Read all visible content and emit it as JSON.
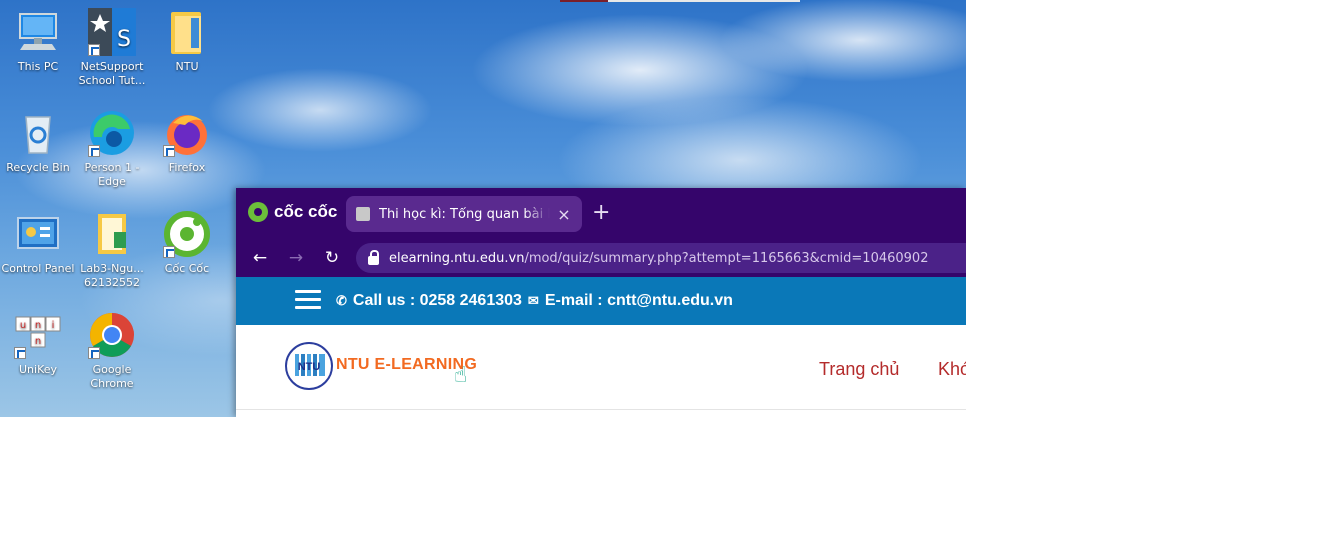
{
  "desktop": {
    "icons": [
      {
        "label": "This PC",
        "icon": "this-pc-icon"
      },
      {
        "label": "NetSupport School Tut...",
        "icon": "netsupport-icon"
      },
      {
        "label": "NTU",
        "icon": "folder-icon"
      },
      {
        "label": "Recycle Bin",
        "icon": "recycle-bin-icon"
      },
      {
        "label": "Person 1 - Edge",
        "icon": "edge-icon"
      },
      {
        "label": "Firefox",
        "icon": "firefox-icon"
      },
      {
        "label": "Control Panel",
        "icon": "control-panel-icon"
      },
      {
        "label": "Lab3-Ngu... 62132552",
        "icon": "document-icon"
      },
      {
        "label": "Cốc Cốc",
        "icon": "coccoc-icon"
      },
      {
        "label": "UniKey",
        "icon": "unikey-icon"
      },
      {
        "label": "Google Chrome",
        "icon": "chrome-icon"
      }
    ]
  },
  "browser": {
    "brand": "cốc cốc",
    "tab": {
      "title": "Thi học kì: Tổng quan bài làm",
      "close": "×"
    },
    "new_tab": "+",
    "address": {
      "host": "elearning.ntu.edu.vn",
      "path": "/mod/quiz/summary.php?attempt=1165663&cmid=10460902"
    }
  },
  "page": {
    "infobar": {
      "phone": "Call us : 0258 2461303",
      "email": "E-mail : cntt@ntu.edu.vn"
    },
    "logo_text": "NTU",
    "site_name": "NTU E-LEARNING",
    "menu": [
      "Trang chủ",
      "Khó"
    ]
  },
  "colors": {
    "tabstrip": "#35056b",
    "infobar": "#0a78b8",
    "menu_text": "#b42b2b",
    "site_name": "#f26a21"
  }
}
